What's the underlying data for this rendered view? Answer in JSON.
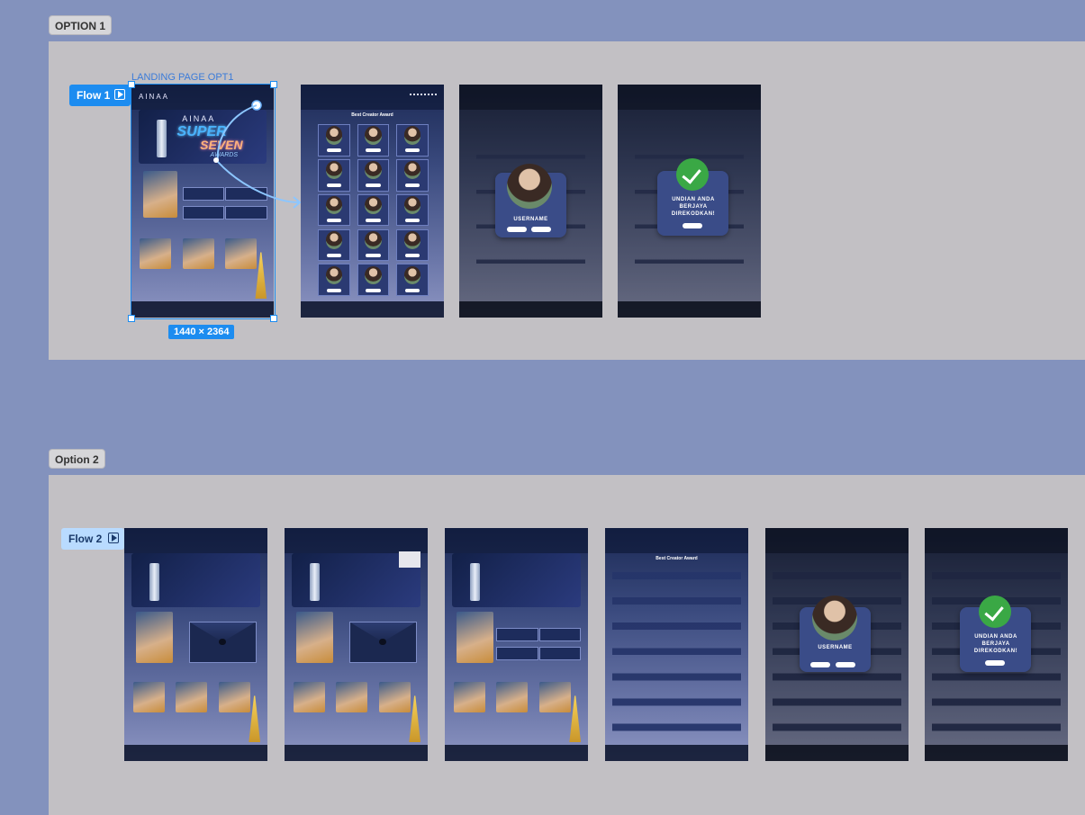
{
  "sections": {
    "option1": {
      "label": "OPTION 1"
    },
    "option2": {
      "label": "Option 2"
    }
  },
  "flows": {
    "flow1": {
      "label": "Flow 1"
    },
    "flow2": {
      "label": "Flow 2"
    }
  },
  "frame_title": "LANDING PAGE OPT1",
  "selection_size": "1440 × 2364",
  "frames": {
    "logo": "AINAA",
    "hero_top": "AINAA",
    "hero_super": "SUPER",
    "hero_seven": "SEVEN",
    "hero_awards": "AWARDS",
    "grid_title": "Best Creator Award",
    "modal_username": "USERNAME",
    "modal_success": "UNDIAN ANDA BERJAYA DIREKODKAN!"
  },
  "colors": {
    "canvas": "#8392bd",
    "section_bg": "#c2c0c4",
    "accent": "#1c8cf0",
    "success": "#3aa845"
  }
}
